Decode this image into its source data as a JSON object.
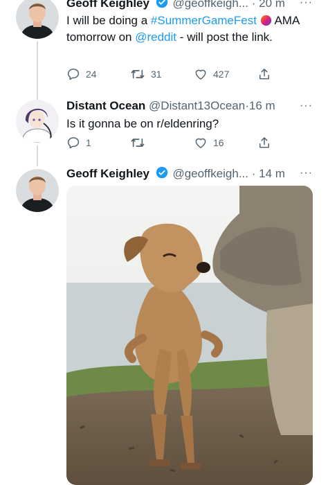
{
  "tweets": [
    {
      "name": "Geoff Keighley",
      "handle": "@geoffkeigh...",
      "time": "20 m",
      "text_parts": [
        "I will be doing a ",
        "#SummerGameFest",
        " AMA tomorrow on ",
        "@reddit",
        " - will post the link."
      ],
      "replies": "24",
      "retweets": "31",
      "likes": "427"
    },
    {
      "name": "Distant Ocean",
      "handle": "@Distant13Ocean",
      "time": "16 m",
      "text": "Is it gonna be on r/eldenring?",
      "replies": "1",
      "retweets": "",
      "likes": "16"
    },
    {
      "name": "Geoff Keighley",
      "handle": "@geoffkeigh...",
      "time": "14 m",
      "media_description": "photo of a small tan dog standing upright on its hind legs next to a crouching person"
    }
  ],
  "separator": "·",
  "more_label": "···",
  "colors": {
    "link": "#1d9bf0",
    "secondary": "#536471",
    "verified": "#1d9bf0"
  },
  "icons": [
    "verified-badge-icon",
    "reply-icon",
    "retweet-icon",
    "like-icon",
    "share-icon",
    "more-icon"
  ]
}
